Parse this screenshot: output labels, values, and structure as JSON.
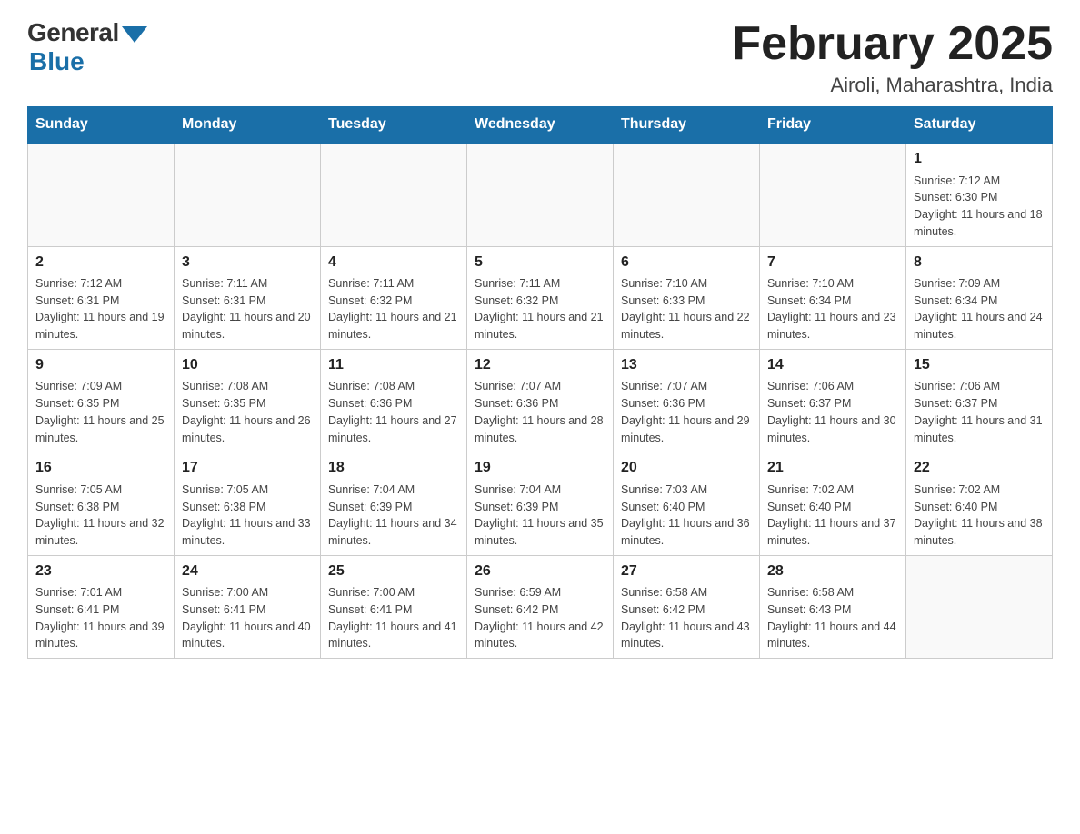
{
  "logo": {
    "general": "General",
    "blue": "Blue"
  },
  "title": "February 2025",
  "subtitle": "Airoli, Maharashtra, India",
  "days_of_week": [
    "Sunday",
    "Monday",
    "Tuesday",
    "Wednesday",
    "Thursday",
    "Friday",
    "Saturday"
  ],
  "weeks": [
    [
      {
        "day": "",
        "info": ""
      },
      {
        "day": "",
        "info": ""
      },
      {
        "day": "",
        "info": ""
      },
      {
        "day": "",
        "info": ""
      },
      {
        "day": "",
        "info": ""
      },
      {
        "day": "",
        "info": ""
      },
      {
        "day": "1",
        "info": "Sunrise: 7:12 AM\nSunset: 6:30 PM\nDaylight: 11 hours and 18 minutes."
      }
    ],
    [
      {
        "day": "2",
        "info": "Sunrise: 7:12 AM\nSunset: 6:31 PM\nDaylight: 11 hours and 19 minutes."
      },
      {
        "day": "3",
        "info": "Sunrise: 7:11 AM\nSunset: 6:31 PM\nDaylight: 11 hours and 20 minutes."
      },
      {
        "day": "4",
        "info": "Sunrise: 7:11 AM\nSunset: 6:32 PM\nDaylight: 11 hours and 21 minutes."
      },
      {
        "day": "5",
        "info": "Sunrise: 7:11 AM\nSunset: 6:32 PM\nDaylight: 11 hours and 21 minutes."
      },
      {
        "day": "6",
        "info": "Sunrise: 7:10 AM\nSunset: 6:33 PM\nDaylight: 11 hours and 22 minutes."
      },
      {
        "day": "7",
        "info": "Sunrise: 7:10 AM\nSunset: 6:34 PM\nDaylight: 11 hours and 23 minutes."
      },
      {
        "day": "8",
        "info": "Sunrise: 7:09 AM\nSunset: 6:34 PM\nDaylight: 11 hours and 24 minutes."
      }
    ],
    [
      {
        "day": "9",
        "info": "Sunrise: 7:09 AM\nSunset: 6:35 PM\nDaylight: 11 hours and 25 minutes."
      },
      {
        "day": "10",
        "info": "Sunrise: 7:08 AM\nSunset: 6:35 PM\nDaylight: 11 hours and 26 minutes."
      },
      {
        "day": "11",
        "info": "Sunrise: 7:08 AM\nSunset: 6:36 PM\nDaylight: 11 hours and 27 minutes."
      },
      {
        "day": "12",
        "info": "Sunrise: 7:07 AM\nSunset: 6:36 PM\nDaylight: 11 hours and 28 minutes."
      },
      {
        "day": "13",
        "info": "Sunrise: 7:07 AM\nSunset: 6:36 PM\nDaylight: 11 hours and 29 minutes."
      },
      {
        "day": "14",
        "info": "Sunrise: 7:06 AM\nSunset: 6:37 PM\nDaylight: 11 hours and 30 minutes."
      },
      {
        "day": "15",
        "info": "Sunrise: 7:06 AM\nSunset: 6:37 PM\nDaylight: 11 hours and 31 minutes."
      }
    ],
    [
      {
        "day": "16",
        "info": "Sunrise: 7:05 AM\nSunset: 6:38 PM\nDaylight: 11 hours and 32 minutes."
      },
      {
        "day": "17",
        "info": "Sunrise: 7:05 AM\nSunset: 6:38 PM\nDaylight: 11 hours and 33 minutes."
      },
      {
        "day": "18",
        "info": "Sunrise: 7:04 AM\nSunset: 6:39 PM\nDaylight: 11 hours and 34 minutes."
      },
      {
        "day": "19",
        "info": "Sunrise: 7:04 AM\nSunset: 6:39 PM\nDaylight: 11 hours and 35 minutes."
      },
      {
        "day": "20",
        "info": "Sunrise: 7:03 AM\nSunset: 6:40 PM\nDaylight: 11 hours and 36 minutes."
      },
      {
        "day": "21",
        "info": "Sunrise: 7:02 AM\nSunset: 6:40 PM\nDaylight: 11 hours and 37 minutes."
      },
      {
        "day": "22",
        "info": "Sunrise: 7:02 AM\nSunset: 6:40 PM\nDaylight: 11 hours and 38 minutes."
      }
    ],
    [
      {
        "day": "23",
        "info": "Sunrise: 7:01 AM\nSunset: 6:41 PM\nDaylight: 11 hours and 39 minutes."
      },
      {
        "day": "24",
        "info": "Sunrise: 7:00 AM\nSunset: 6:41 PM\nDaylight: 11 hours and 40 minutes."
      },
      {
        "day": "25",
        "info": "Sunrise: 7:00 AM\nSunset: 6:41 PM\nDaylight: 11 hours and 41 minutes."
      },
      {
        "day": "26",
        "info": "Sunrise: 6:59 AM\nSunset: 6:42 PM\nDaylight: 11 hours and 42 minutes."
      },
      {
        "day": "27",
        "info": "Sunrise: 6:58 AM\nSunset: 6:42 PM\nDaylight: 11 hours and 43 minutes."
      },
      {
        "day": "28",
        "info": "Sunrise: 6:58 AM\nSunset: 6:43 PM\nDaylight: 11 hours and 44 minutes."
      },
      {
        "day": "",
        "info": ""
      }
    ]
  ]
}
